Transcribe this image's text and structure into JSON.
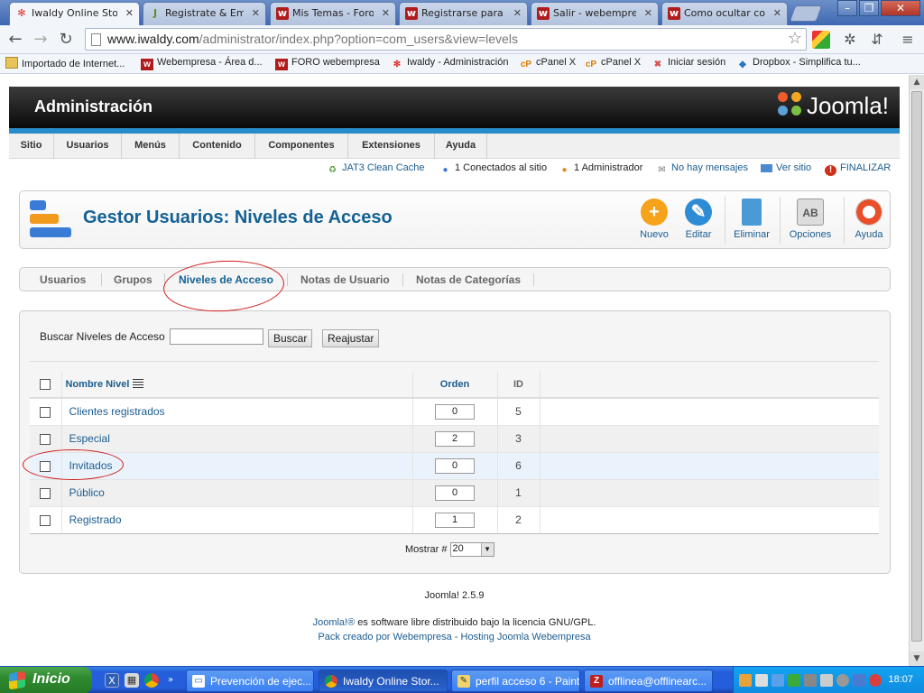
{
  "browser": {
    "tabs": [
      {
        "label": "Iwaldy Online Stor",
        "icon": "joomla-icon",
        "active": true
      },
      {
        "label": "Registrate & Empie",
        "icon": "j-icon",
        "active": false
      },
      {
        "label": "Mis Temas - Foro J",
        "icon": "webempresa-icon",
        "active": false
      },
      {
        "label": "Registrarse para le",
        "icon": "webempresa-icon",
        "active": false
      },
      {
        "label": "Salir - webempresa",
        "icon": "webempresa-icon",
        "active": false
      },
      {
        "label": "Como ocultar cont",
        "icon": "webempresa-icon",
        "active": false
      }
    ],
    "url_host": "www.iwaldy.com",
    "url_path": "/administrator/index.php?option=com_users&view=levels",
    "bookmarks": [
      {
        "label": "Importado de Internet...",
        "icon": "folder-icon"
      },
      {
        "label": "Webempresa - Área d...",
        "icon": "webempresa-icon"
      },
      {
        "label": "FORO webempresa",
        "icon": "webempresa-icon"
      },
      {
        "label": "Iwaldy - Administración",
        "icon": "joomla-icon"
      },
      {
        "label": "cPanel X",
        "icon": "cpanel-icon"
      },
      {
        "label": "cPanel X",
        "icon": "cpanel-icon"
      },
      {
        "label": "Iniciar sesión",
        "icon": "x-icon"
      },
      {
        "label": "Dropbox - Simplifica tu...",
        "icon": "dropbox-icon"
      }
    ]
  },
  "admin": {
    "header_title": "Administración",
    "logo_text": "Joomla!",
    "menu": [
      "Sitio",
      "Usuarios",
      "Menús",
      "Contenido",
      "Componentes",
      "Extensiones",
      "Ayuda"
    ],
    "status": {
      "cache": "JAT3 Clean Cache",
      "connected": "1 Conectados al sitio",
      "admins": "1 Administrador",
      "messages": "No hay mensajes",
      "view_site": "Ver sitio",
      "logout": "FINALIZAR"
    },
    "page_title": "Gestor Usuarios: Niveles de Acceso",
    "toolbar": {
      "new": "Nuevo",
      "edit": "Editar",
      "delete": "Eliminar",
      "options": "Opciones",
      "help": "Ayuda"
    },
    "subnav": [
      "Usuarios",
      "Grupos",
      "Niveles de Acceso",
      "Notas de Usuario",
      "Notas de Categorías"
    ],
    "subnav_active": "Niveles de Acceso",
    "filter": {
      "label": "Buscar Niveles de Acceso",
      "value": "",
      "search_button": "Buscar",
      "reset_button": "Reajustar"
    },
    "table": {
      "columns": {
        "name": "Nombre Nivel",
        "order": "Orden",
        "id": "ID"
      },
      "rows": [
        {
          "name": "Clientes registrados",
          "order": "0",
          "id": "5"
        },
        {
          "name": "Especial",
          "order": "2",
          "id": "3"
        },
        {
          "name": "Invitados",
          "order": "0",
          "id": "6"
        },
        {
          "name": "Público",
          "order": "0",
          "id": "1"
        },
        {
          "name": "Registrado",
          "order": "1",
          "id": "2"
        }
      ]
    },
    "pagination": {
      "label": "Mostrar #",
      "value": "20"
    },
    "footer": {
      "version": "Joomla! 2.5.9",
      "license_link": "Joomla!®",
      "license_text": " es software libre distribuido bajo la licencia GNU/GPL.",
      "credits": "Pack creado por Webempresa - Hosting Joomla Webempresa"
    }
  },
  "taskbar": {
    "start_label": "Inicio",
    "tasks": [
      {
        "label": "Prevención de ejec...",
        "icon": "window-icon",
        "active": false
      },
      {
        "label": "Iwaldy Online Stor...",
        "icon": "chrome-icon",
        "active": true
      },
      {
        "label": "perfil acceso 6 - Paint",
        "icon": "paint-icon",
        "active": false
      },
      {
        "label": "offlinea@offlinearc...",
        "icon": "filezilla-icon",
        "active": false
      }
    ],
    "clock": "18:07"
  }
}
